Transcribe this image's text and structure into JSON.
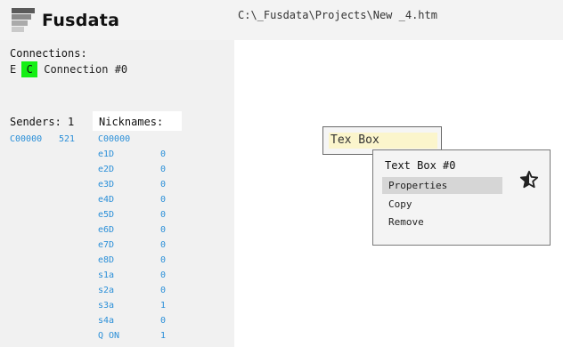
{
  "app": {
    "title": "Fusdata"
  },
  "file": {
    "path": "C:\\_Fusdata\\Projects\\New _4.htm"
  },
  "connections": {
    "title": "Connections:",
    "e_label": "E",
    "c_label": "C",
    "name": "Connection #0",
    "status_color": "#14ef14"
  },
  "senders": {
    "header": "Senders: 1",
    "items": [
      {
        "id": "C00000",
        "count": "521"
      }
    ]
  },
  "nicknames": {
    "header": "Nicknames:",
    "title_row": "C00000",
    "items": [
      {
        "name": "e1D",
        "value": "0"
      },
      {
        "name": "e2D",
        "value": "0"
      },
      {
        "name": "e3D",
        "value": "0"
      },
      {
        "name": "e4D",
        "value": "0"
      },
      {
        "name": "e5D",
        "value": "0"
      },
      {
        "name": "e6D",
        "value": "0"
      },
      {
        "name": "e7D",
        "value": "0"
      },
      {
        "name": "e8D",
        "value": "0"
      },
      {
        "name": "s1a",
        "value": "0"
      },
      {
        "name": "s2a",
        "value": "0"
      },
      {
        "name": "s3a",
        "value": "1"
      },
      {
        "name": "s4a",
        "value": "0"
      },
      {
        "name": "Q ON",
        "value": "1"
      }
    ]
  },
  "canvas": {
    "textbox": {
      "text": "Tex Box"
    },
    "popup": {
      "title": "Text Box #0",
      "icon": "star-half-icon",
      "items": [
        {
          "label": "Properties",
          "selected": true
        },
        {
          "label": "Copy",
          "selected": false
        },
        {
          "label": "Remove",
          "selected": false
        }
      ]
    }
  },
  "colors": {
    "accent_link": "#2a8fd8",
    "highlight": "#fbf5cc",
    "menu_selected": "#d6d6d6"
  }
}
